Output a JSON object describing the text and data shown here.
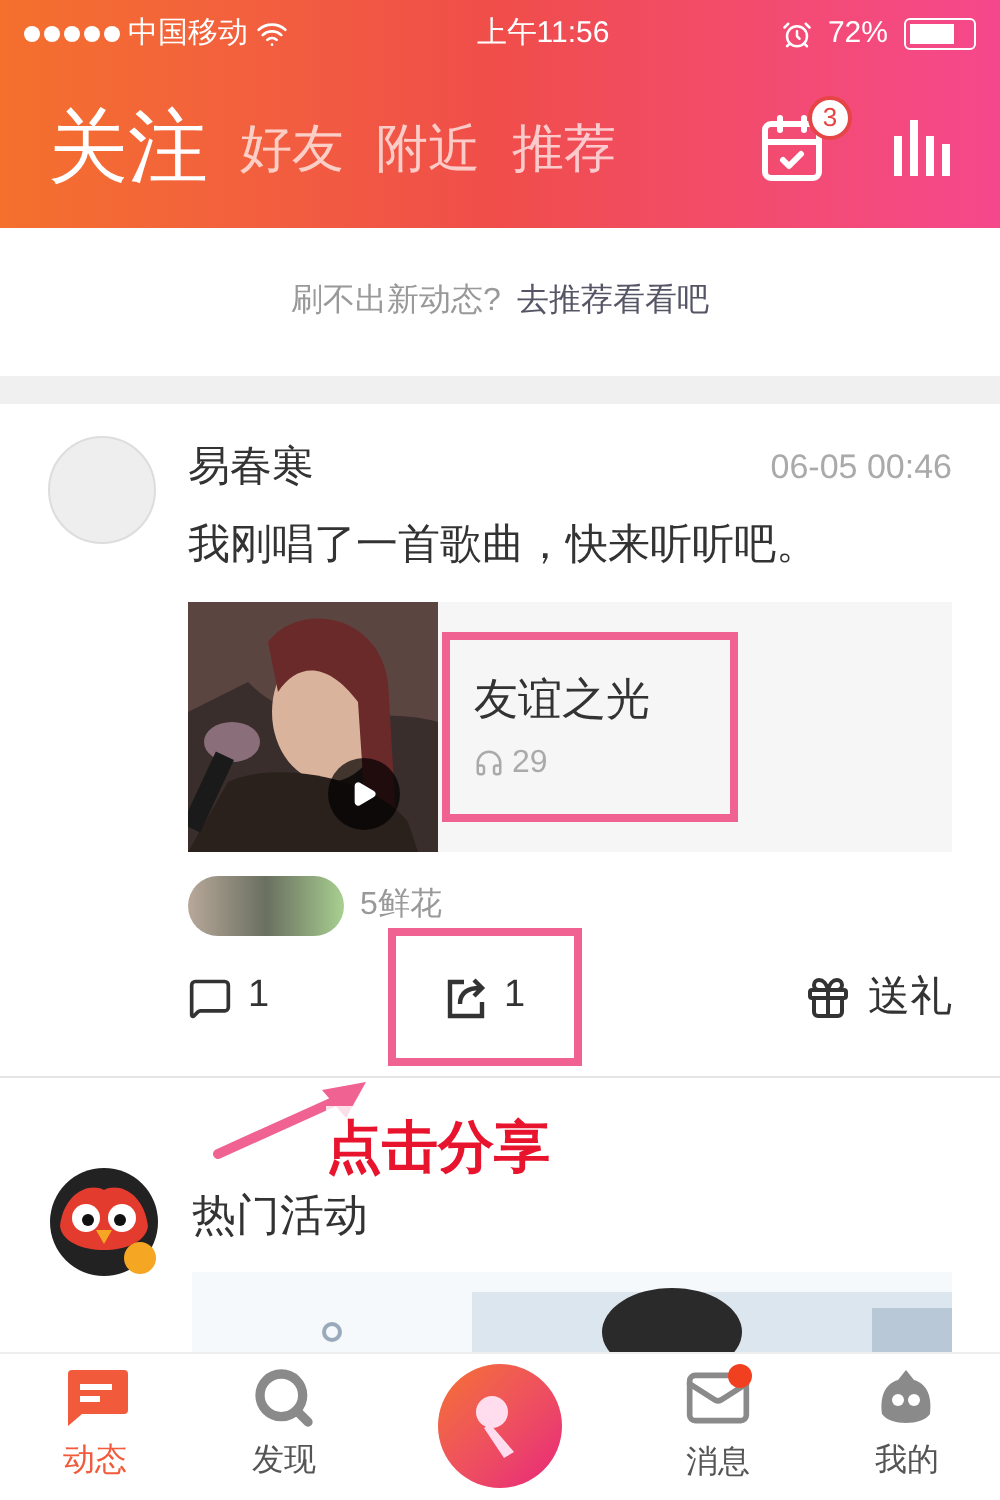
{
  "status_bar": {
    "carrier": "中国移动",
    "time": "上午11:56",
    "battery": "72%"
  },
  "tabs": [
    {
      "label": "关注",
      "selected": true
    },
    {
      "label": "好友",
      "selected": false
    },
    {
      "label": "附近",
      "selected": false
    },
    {
      "label": "推荐",
      "selected": false
    }
  ],
  "header": {
    "calendar_badge": "3"
  },
  "notice": {
    "text": "刷不出新动态?",
    "link": "去推荐看看吧"
  },
  "posts": [
    {
      "kind": "song",
      "author": "易春寒",
      "time": "06-05 00:46",
      "text": "我刚唱了一首歌曲，快来听听吧。",
      "song": {
        "title": "友谊之光",
        "plays": "29",
        "highlighted": true
      },
      "flowers": "5鲜花",
      "actions": {
        "comments": "1",
        "shares": "1",
        "shares_highlighted": true,
        "gift": "送礼"
      }
    },
    {
      "kind": "activity",
      "author": "热门活动"
    }
  ],
  "annotation": {
    "label": "点击分享"
  },
  "nav": [
    {
      "kind": "tab",
      "label": "动态",
      "selected": true,
      "dot": false
    },
    {
      "kind": "tab",
      "label": "发现",
      "selected": false,
      "dot": false
    },
    {
      "kind": "record"
    },
    {
      "kind": "tab",
      "label": "消息",
      "selected": false,
      "dot": true
    },
    {
      "kind": "tab",
      "label": "我的",
      "selected": false,
      "dot": false
    }
  ]
}
